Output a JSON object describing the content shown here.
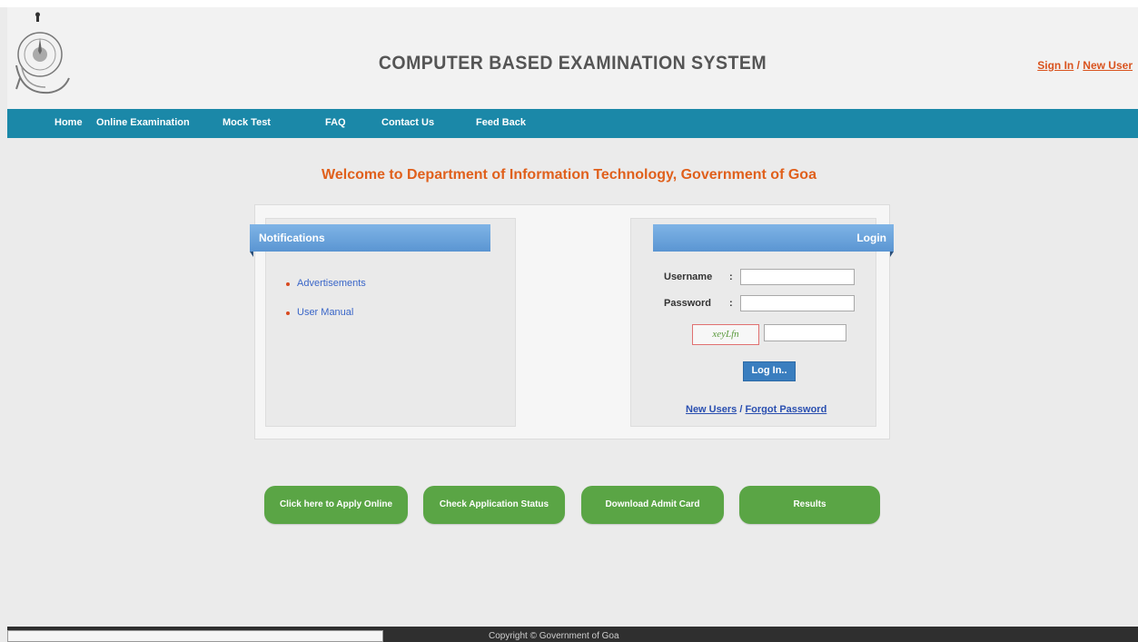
{
  "header": {
    "title": "COMPUTER BASED EXAMINATION SYSTEM",
    "signin_label": "Sign In",
    "separator": "/",
    "new_user_label": "New User"
  },
  "nav": {
    "items": [
      "Home",
      "Online Examination",
      "Mock Test",
      "FAQ",
      "Contact Us",
      "Feed Back"
    ]
  },
  "welcome": "Welcome to Department of Information Technology, Government of Goa",
  "notifications": {
    "title": "Notifications",
    "items": [
      "Advertisements",
      "User Manual"
    ]
  },
  "login": {
    "title": "Login",
    "username_label": "Username",
    "password_label": "Password",
    "colon": ":",
    "username_value": "",
    "password_value": "",
    "captcha_text": "xeyLfn",
    "captcha_input_value": "",
    "login_button": "Log In..",
    "new_users_link": "New Users",
    "link_separator": "/",
    "forgot_password_link": "Forgot Password"
  },
  "actions": [
    "Click here to Apply Online",
    "Check Application Status",
    "Download Admit Card",
    "Results"
  ],
  "footer": {
    "copyright": "Copyright © Government of Goa"
  },
  "colors": {
    "nav_bar": "#1b88a8",
    "accent_orange": "#e0601c",
    "action_green": "#5aa545",
    "ribbon_blue": "#6aa4dc"
  }
}
